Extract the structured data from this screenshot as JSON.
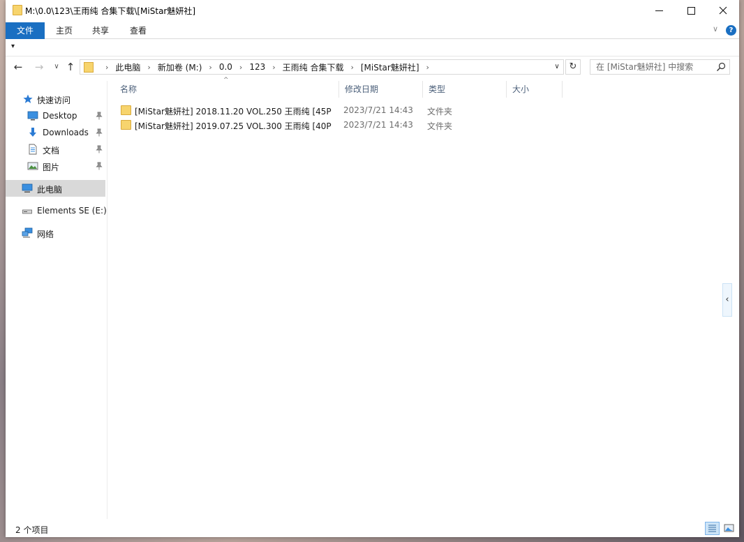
{
  "window": {
    "title": "M:\\0.0\\123\\王雨纯 合集下载\\[MiStar魅妍社]"
  },
  "ribbon": {
    "tabs": [
      {
        "label": "文件"
      },
      {
        "label": "主页"
      },
      {
        "label": "共享"
      },
      {
        "label": "查看"
      }
    ],
    "expand_glyph": "∨",
    "help_glyph": "?"
  },
  "qat": {
    "customize_glyph": "▾"
  },
  "nav": {
    "back_glyph": "←",
    "forward_glyph": "→",
    "recent_glyph": "∨",
    "up_glyph": "↑",
    "refresh_glyph": "↻",
    "breadcrumbs": [
      "此电脑",
      "新加卷 (M:)",
      "0.0",
      "123",
      "王雨纯 合集下载",
      "[MiStar魅妍社]"
    ],
    "separator": "›",
    "dropdown_glyph": "∨"
  },
  "search": {
    "placeholder": "在 [MiStar魅妍社] 中搜索"
  },
  "sidebar": {
    "quick_access": "快速访问",
    "items": [
      {
        "label": "Desktop",
        "icon": "desktop-icon",
        "pinned": true
      },
      {
        "label": "Downloads",
        "icon": "downloads-icon",
        "pinned": true
      },
      {
        "label": "文档",
        "icon": "documents-icon",
        "pinned": true
      },
      {
        "label": "图片",
        "icon": "pictures-icon",
        "pinned": true
      }
    ],
    "this_pc": "此电脑",
    "drive": "Elements SE (E:)",
    "network": "网络"
  },
  "filelist": {
    "columns": {
      "name": "名称",
      "date": "修改日期",
      "type": "类型",
      "size": "大小"
    },
    "sort_glyph": "^",
    "rows": [
      {
        "name": "[MiStar魅妍社] 2018.11.20 VOL.250 王雨纯 [45P",
        "date": "2023/7/21 14:43",
        "type": "文件夹"
      },
      {
        "name": "[MiStar魅妍社] 2019.07.25 VOL.300 王雨纯 [40P",
        "date": "2023/7/21 14:43",
        "type": "文件夹"
      }
    ]
  },
  "preview_toggle_glyph": "‹",
  "status": {
    "item_count": "2 个项目"
  },
  "colors": {
    "accent": "#1a6fc2",
    "folder": "#f7d46d",
    "selected": "#d9d9d9"
  }
}
